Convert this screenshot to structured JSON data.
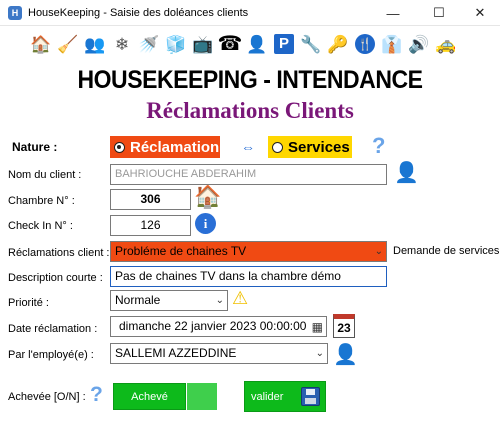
{
  "window": {
    "title": "HouseKeeping - Saisie des doléances clients",
    "controls": [
      "—",
      "☐",
      "✕"
    ]
  },
  "toolbar": [
    {
      "icon": "home-icon",
      "glyph": "🏠"
    },
    {
      "icon": "cleaning-staff-icon",
      "glyph": "🧹"
    },
    {
      "icon": "staff-group-icon",
      "glyph": "👥"
    },
    {
      "icon": "air-conditioner-icon",
      "glyph": "❄"
    },
    {
      "icon": "shower-icon",
      "glyph": "🚿"
    },
    {
      "icon": "minibar-icon",
      "glyph": "🧊"
    },
    {
      "icon": "tv-icon",
      "glyph": "📺"
    },
    {
      "icon": "telephone-icon",
      "glyph": "☎"
    },
    {
      "icon": "receptionist-icon",
      "glyph": "👤"
    },
    {
      "icon": "parking-icon",
      "glyph": "P"
    },
    {
      "icon": "tools-icon",
      "glyph": "🔧"
    },
    {
      "icon": "key-icon",
      "glyph": "🔑"
    },
    {
      "icon": "restaurant-icon",
      "glyph": "🍴"
    },
    {
      "icon": "hanger-icon",
      "glyph": "👔"
    },
    {
      "icon": "speaker-icon",
      "glyph": "🔊"
    },
    {
      "icon": "taxi-icon",
      "glyph": "🚕"
    }
  ],
  "header": {
    "title": "HOUSEKEEPING - INTENDANCE",
    "subtitle": "Réclamations Clients"
  },
  "form": {
    "nature_label": "Nature  :",
    "nature_option_reclamation": "Réclamation",
    "nature_option_services": "Services",
    "client_label": "Nom du client  :",
    "client_value": "BAHRIOUCHE ABDERAHIM",
    "chambre_label": "Chambre N° :",
    "chambre_value": "306",
    "checkin_label": "Check In  N° :",
    "checkin_value": "126",
    "reclamation_label": "Réclamations client :",
    "reclamation_value": "Probléme de chaines TV",
    "demande_label": "Demande de services",
    "description_label": "Description  courte :",
    "description_value": "Pas de chaines TV dans la chambre démo",
    "priorite_label": "Priorité   :",
    "priorite_value": "Normale",
    "date_label": "Date réclamation   :",
    "date_value": "dimanche 22 janvier 2023 00:00:00",
    "calendar_day": "23",
    "employe_label": "Par l'employé(e) :",
    "employe_value": "SALLEMI AZZEDDINE",
    "achevee_label": "Achevée [O/N]  :",
    "achevee_button": "Achevé",
    "valider_button": "valider"
  },
  "colors": {
    "reclamation_bg": "#f04a13",
    "services_bg": "#ffd700",
    "subtitle": "#7a1778",
    "green": "#0dba1b"
  }
}
